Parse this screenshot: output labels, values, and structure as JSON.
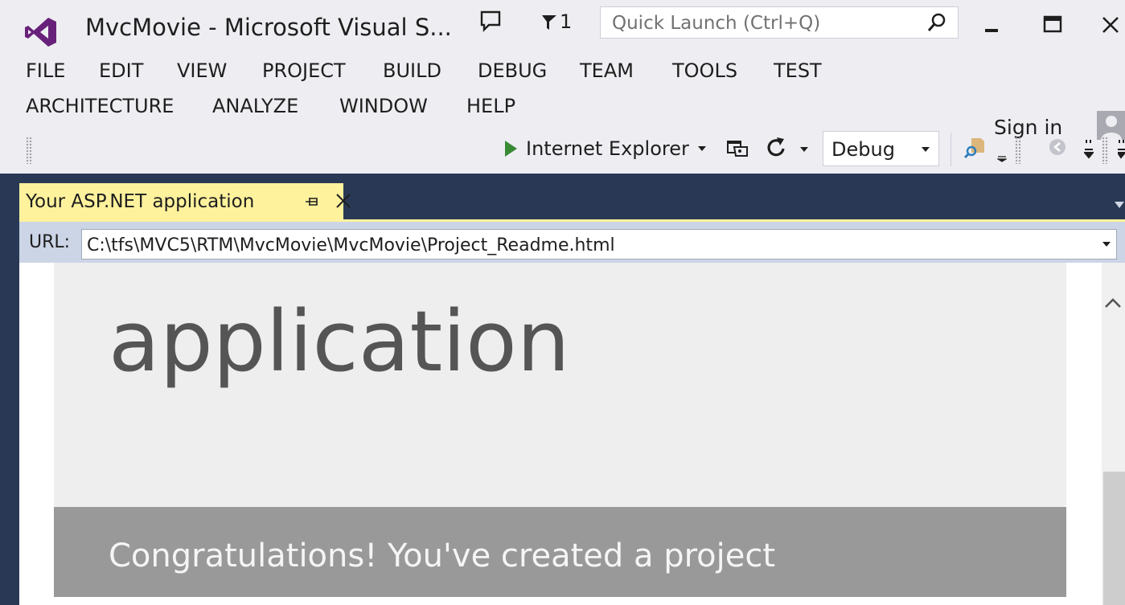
{
  "window": {
    "title": "MvcMovie - Microsoft Visual S...",
    "notification_count": "1",
    "quick_launch_placeholder": "Quick Launch (Ctrl+Q)"
  },
  "menu": {
    "row1": [
      "FILE",
      "EDIT",
      "VIEW",
      "PROJECT",
      "BUILD",
      "DEBUG",
      "TEAM",
      "TOOLS",
      "TEST"
    ],
    "row2": [
      "ARCHITECTURE",
      "ANALYZE",
      "WINDOW",
      "HELP"
    ],
    "sign_in": "Sign in"
  },
  "toolbar": {
    "run_target": "Internet Explorer",
    "configuration": "Debug"
  },
  "document_tab": {
    "title": "Your ASP.NET application"
  },
  "urlbar": {
    "label": "URL:",
    "value": "C:\\tfs\\MVC5\\RTM\\MvcMovie\\MvcMovie\\Project_Readme.html"
  },
  "page": {
    "hero_title": "application",
    "banner_text": "Congratulations! You've created a project"
  },
  "colors": {
    "tab_well": "#293955",
    "active_tab": "#fff29d",
    "vs_purple": "#68217a",
    "run_green": "#388a34"
  }
}
